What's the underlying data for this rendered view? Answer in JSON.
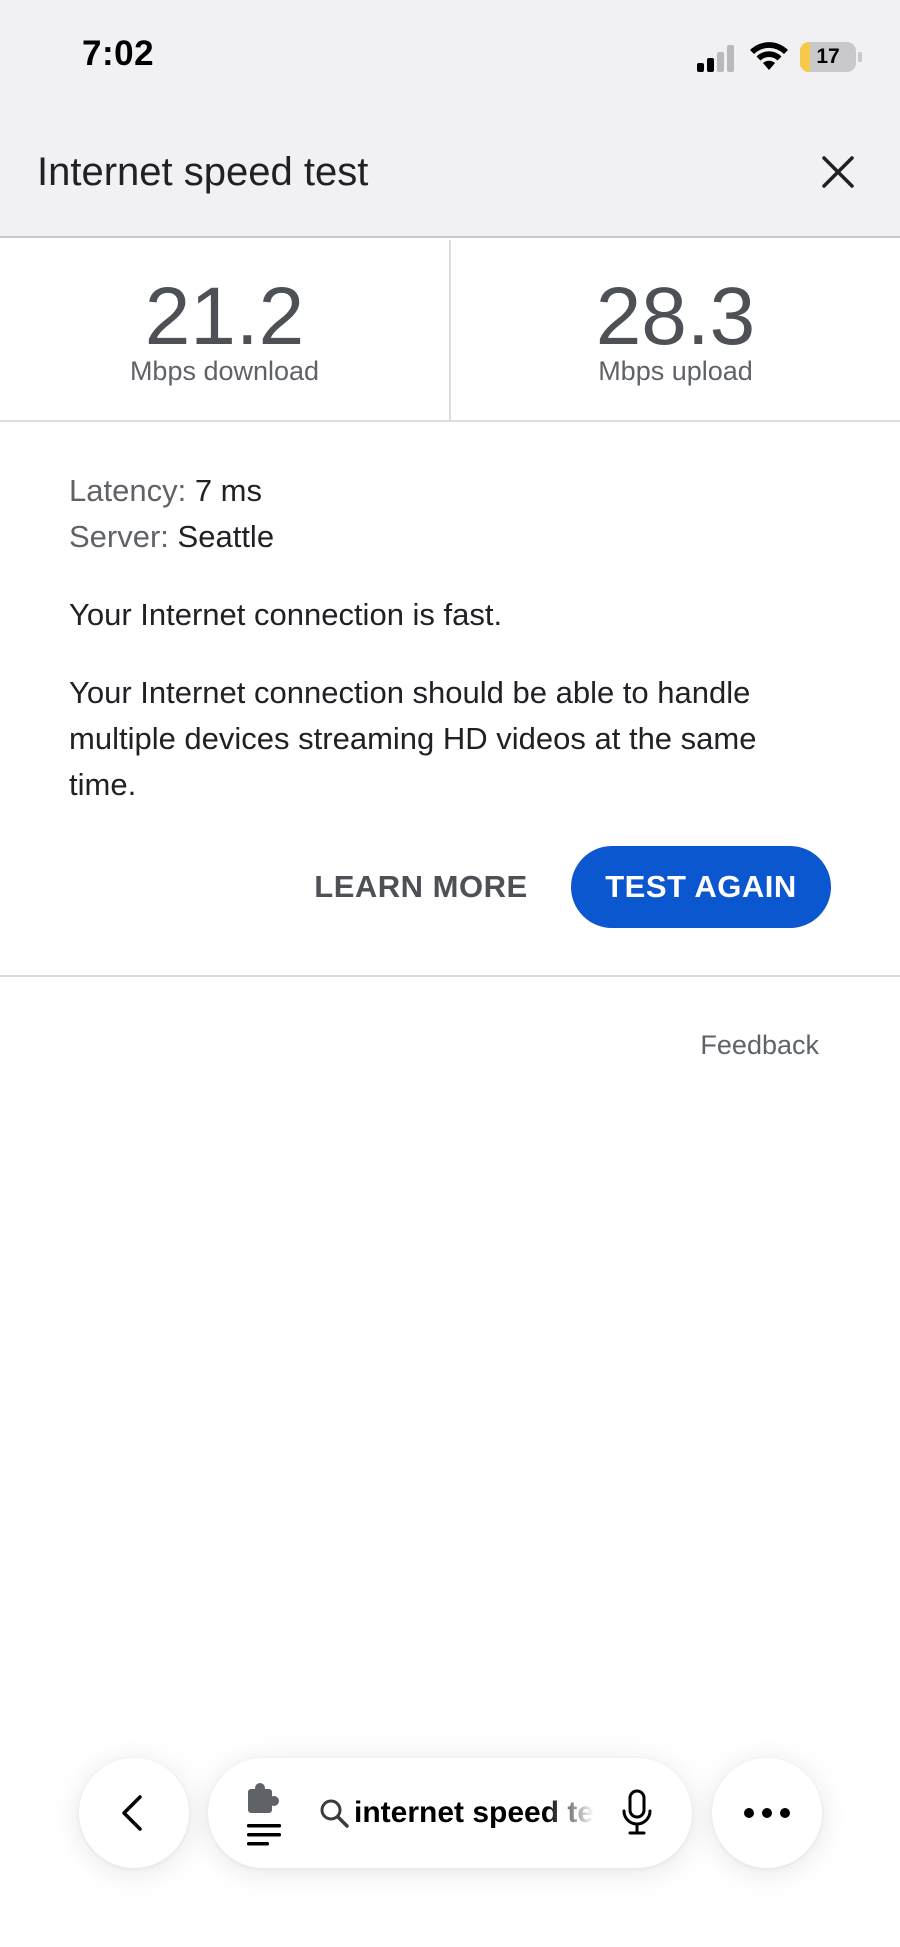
{
  "status_bar": {
    "time": "7:02",
    "battery_level": "17",
    "battery_fraction": 0.17,
    "battery_color": "#f7c948",
    "signal_bars_active": 2,
    "signal_bars_total": 4
  },
  "header": {
    "title": "Internet speed test",
    "close_icon": "close-icon"
  },
  "results": {
    "download_value": "21.2",
    "download_unit": "Mbps download",
    "upload_value": "28.3",
    "upload_unit": "Mbps upload"
  },
  "details": {
    "latency_label": "Latency:",
    "latency_value": "7 ms",
    "server_label": "Server:",
    "server_value": "Seattle",
    "verdict": "Your Internet connection is fast.",
    "description": "Your Internet connection should be able to handle multiple devices streaming HD videos at the same time."
  },
  "actions": {
    "learn_more": "LEARN MORE",
    "test_again": "TEST AGAIN",
    "accent_color": "#0b57d0"
  },
  "footer": {
    "feedback": "Feedback"
  },
  "toolbar": {
    "back_icon": "chevron-left-icon",
    "extension_icon": "puzzle-icon",
    "reader_icon": "text-lines-icon",
    "search_icon": "search-icon",
    "search_text": "internet speed test",
    "mic_icon": "microphone-icon",
    "more_icon": "more-dots-icon"
  }
}
